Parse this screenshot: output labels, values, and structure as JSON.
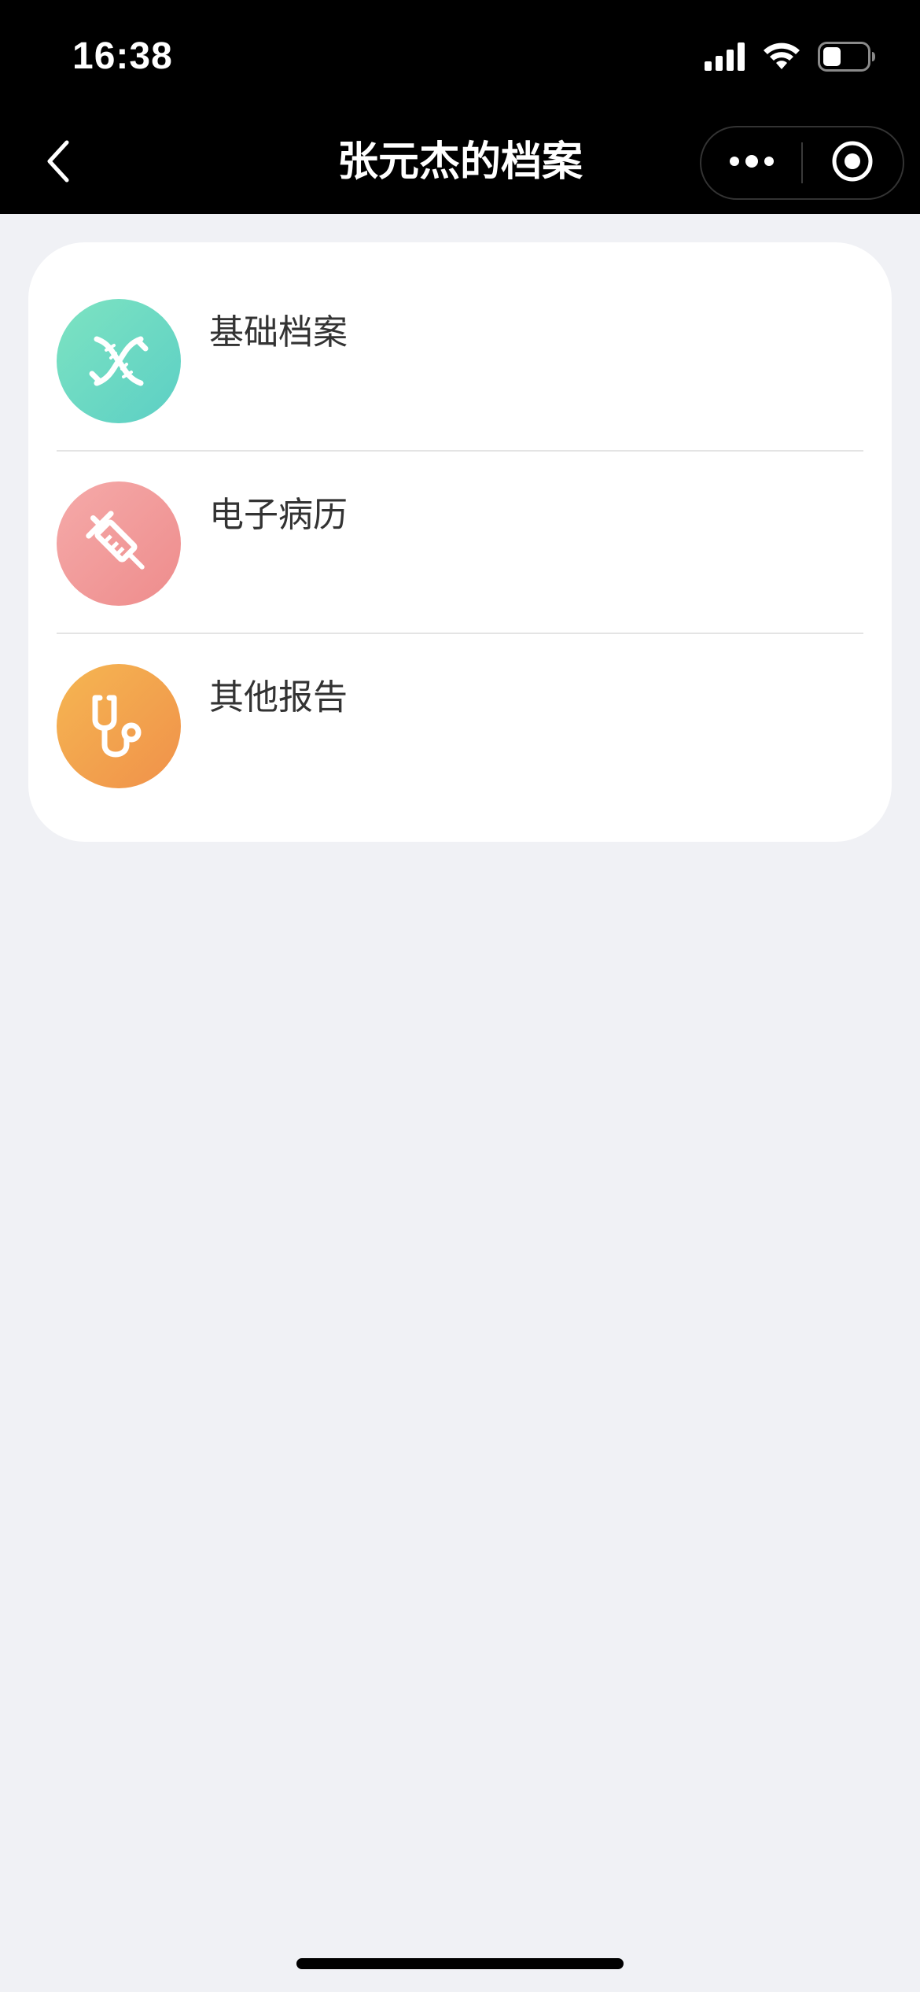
{
  "status_bar": {
    "time": "16:38",
    "icons": [
      "cellular-signal-icon",
      "wifi-icon",
      "battery-icon"
    ]
  },
  "nav": {
    "title": "张元杰的档案",
    "back_icon": "chevron-left-icon",
    "capsule": [
      "more-dots-icon",
      "close-target-icon"
    ]
  },
  "menu": {
    "items": [
      {
        "label": "基础档案",
        "icon": "dna-icon",
        "color_from": "#7de3c2",
        "color_to": "#5ccfc4"
      },
      {
        "label": "电子病历",
        "icon": "syringe-icon",
        "color_from": "#f5aaa9",
        "color_to": "#ee8c8c"
      },
      {
        "label": "其他报告",
        "icon": "stethoscope-icon",
        "color_from": "#f5b652",
        "color_to": "#f0914a"
      }
    ]
  },
  "colors": {
    "page_bg": "#f0f1f5",
    "header_bg": "#000000",
    "card_bg": "#ffffff"
  }
}
